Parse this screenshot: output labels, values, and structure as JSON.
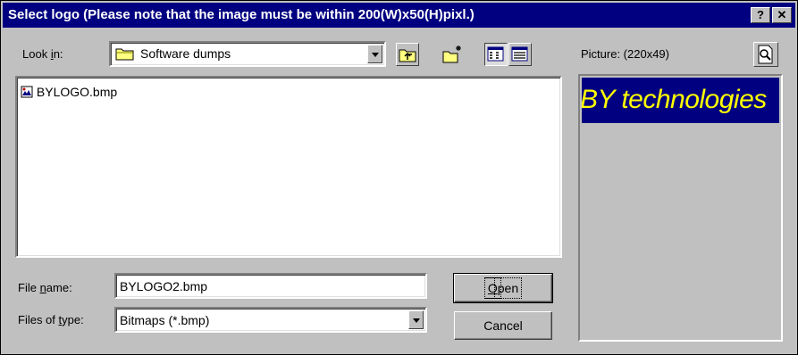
{
  "window": {
    "title": "Select logo (Please note that the image must be within 200(W)x50(H)pixl.)",
    "help_button": "?",
    "close_button": "✕"
  },
  "lookin": {
    "label_pre": "Look ",
    "label_u": "i",
    "label_post": "n:",
    "value": "Software dumps"
  },
  "toolbar": {
    "icons": [
      "up-one-level-icon",
      "create-new-folder-icon",
      "list-view-icon",
      "details-view-icon"
    ]
  },
  "files": [
    {
      "name": "BYLOGO.bmp",
      "icon": "bitmap-file-icon"
    }
  ],
  "filename": {
    "label_pre": "File ",
    "label_u": "n",
    "label_post": "ame:",
    "value": "BYLOGO2.bmp"
  },
  "filetype": {
    "label_pre": "Files of ",
    "label_u": "t",
    "label_post": "ype:",
    "value": "Bitmaps (*.bmp)"
  },
  "buttons": {
    "open_u": "O",
    "open_rest": "pen",
    "cancel": "Cancel"
  },
  "preview": {
    "label": "Picture: (220x49)",
    "logo_text": "BY technologies",
    "logo_bg": "#000080",
    "logo_fg": "#ffff00"
  }
}
